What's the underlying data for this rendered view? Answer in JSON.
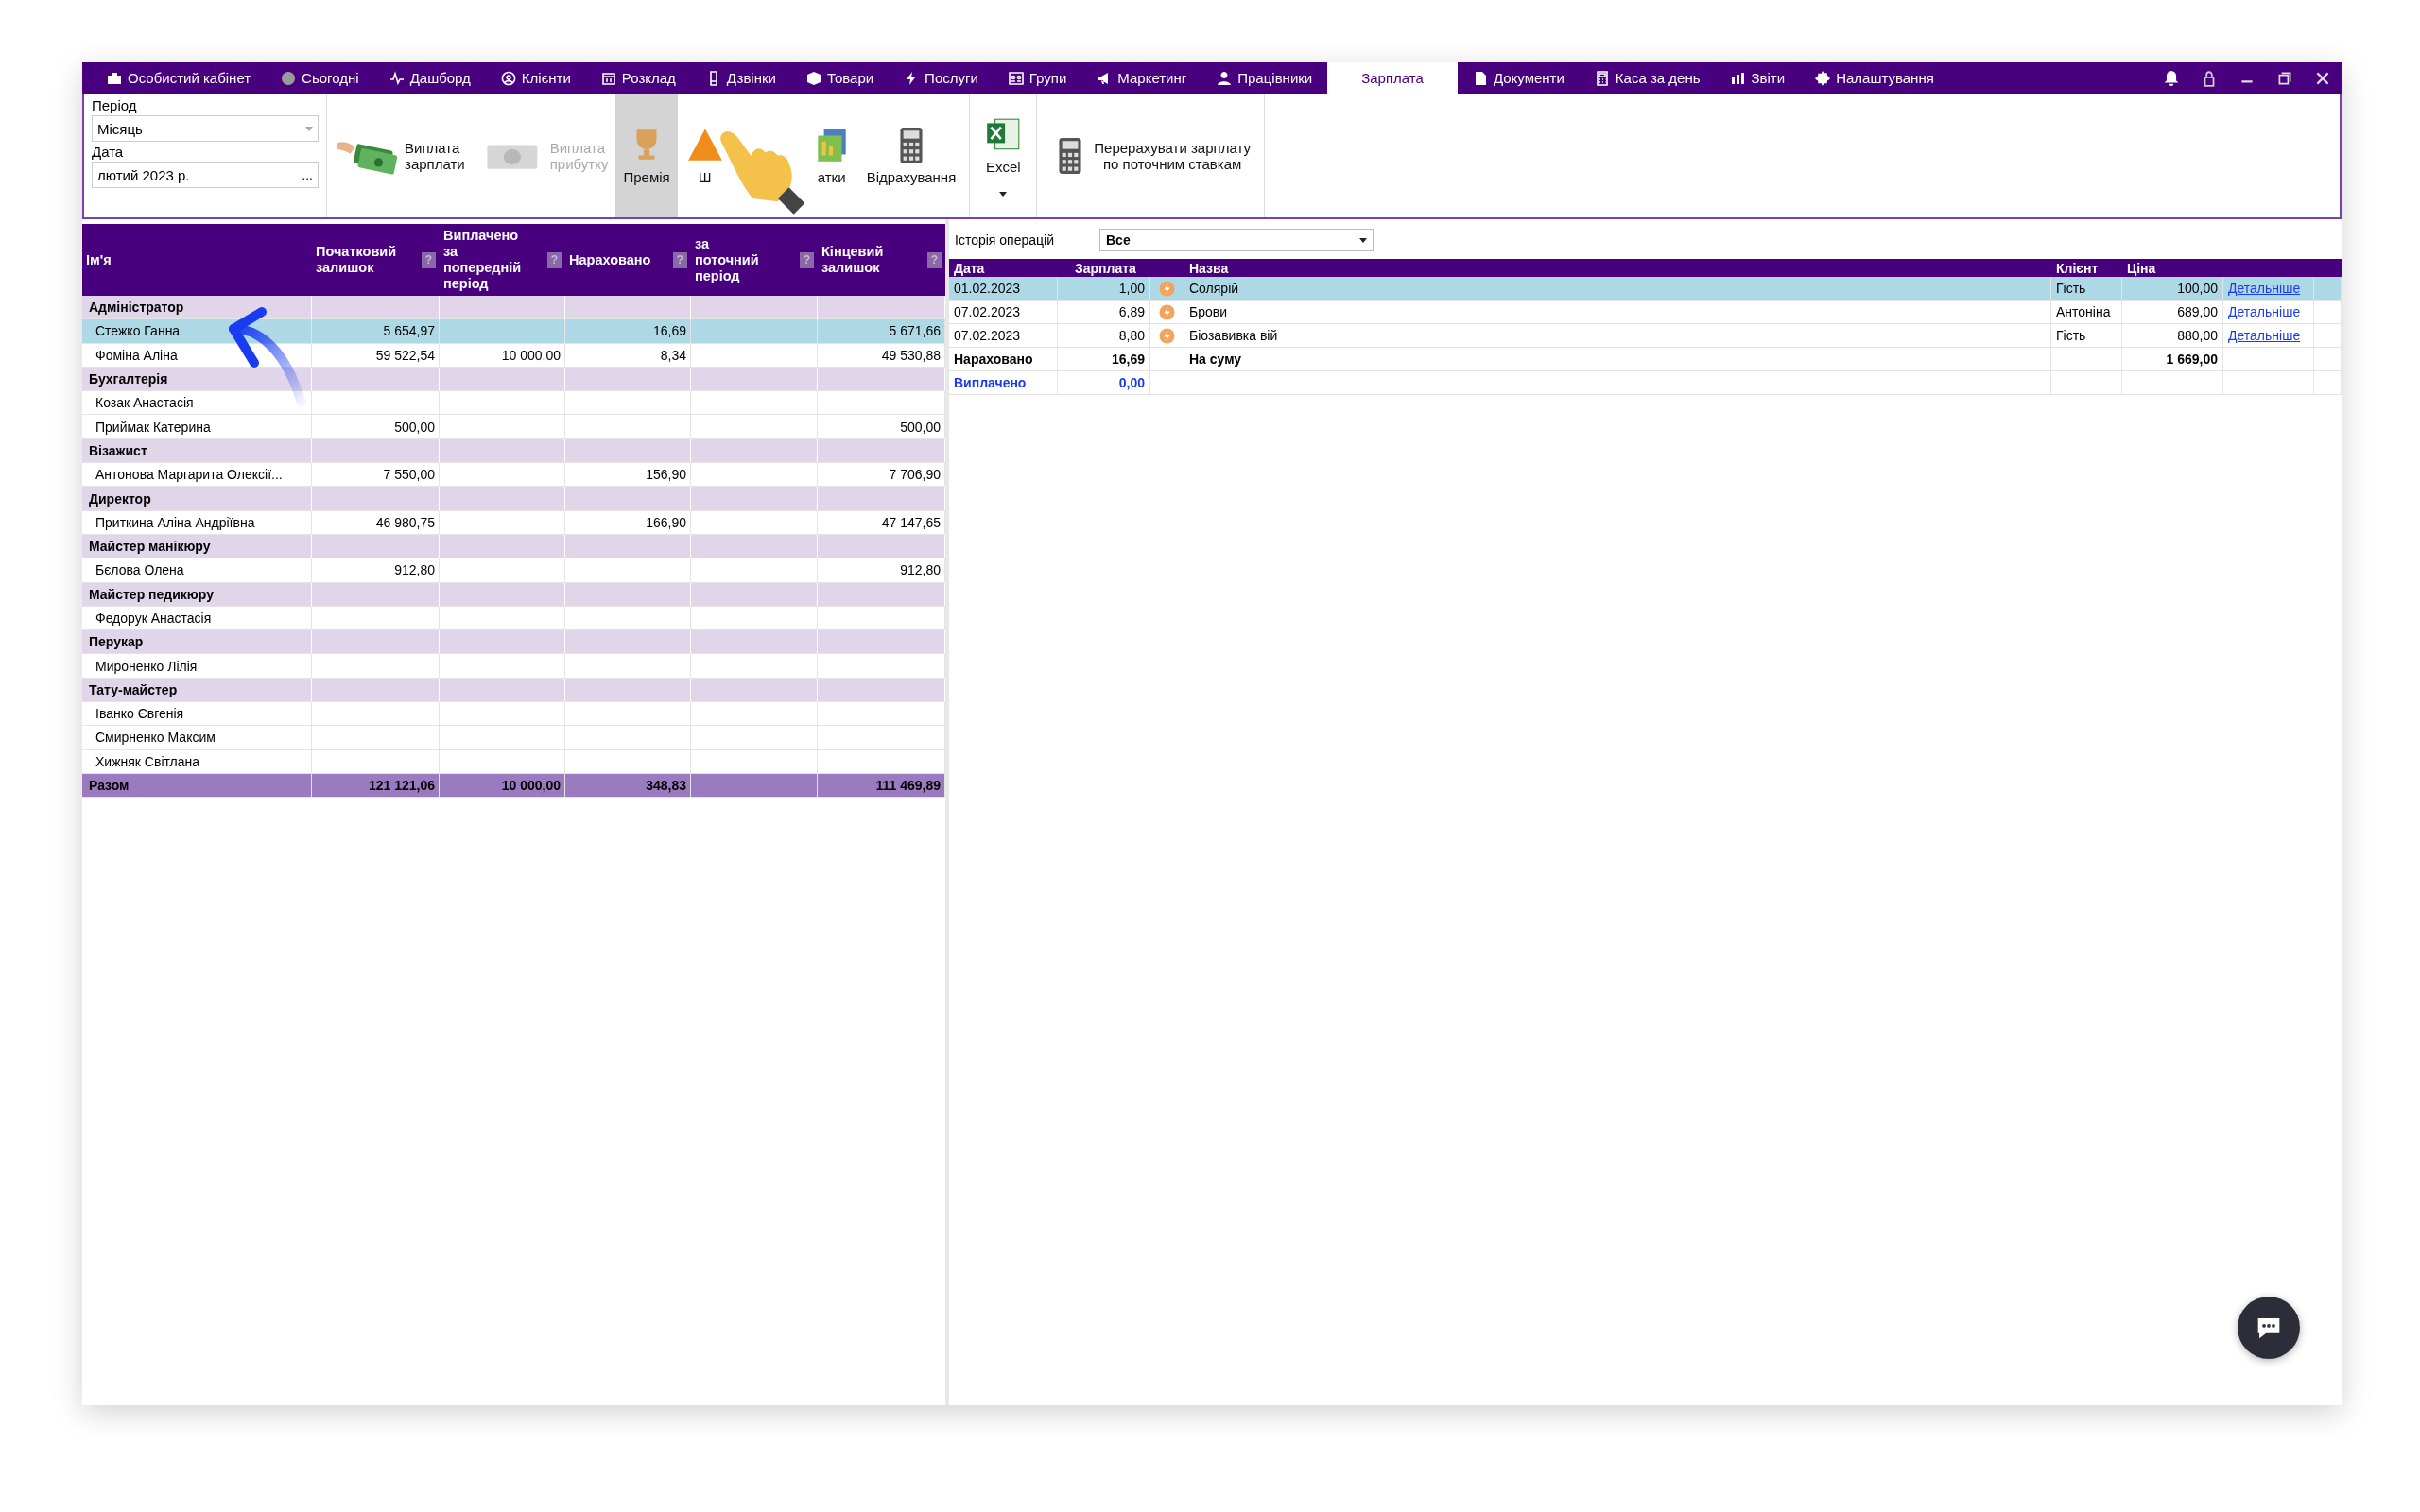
{
  "menu": {
    "items": [
      {
        "label": "Особистий кабінет",
        "selected": false
      },
      {
        "label": "Сьогодні",
        "selected": false
      },
      {
        "label": "Дашборд",
        "selected": false
      },
      {
        "label": "Клієнти",
        "selected": false
      },
      {
        "label": "Розклад",
        "selected": false
      },
      {
        "label": "Дзвінки",
        "selected": false
      },
      {
        "label": "Товари",
        "selected": false
      },
      {
        "label": "Послуги",
        "selected": false
      },
      {
        "label": "Групи",
        "selected": false
      },
      {
        "label": "Маркетинг",
        "selected": false
      },
      {
        "label": "Працівники",
        "selected": false
      },
      {
        "label": "Зарплата",
        "selected": true
      },
      {
        "label": "Документи",
        "selected": false
      },
      {
        "label": "Каса за день",
        "selected": false
      },
      {
        "label": "Звіти",
        "selected": false
      },
      {
        "label": "Налаштування",
        "selected": false
      }
    ]
  },
  "toolbar": {
    "period": {
      "label": "Період",
      "value": "Місяць"
    },
    "date": {
      "label": "Дата",
      "value": "лютий  2023 р.",
      "button": "..."
    },
    "buttons": [
      {
        "label": "Виплата\nзарплати",
        "disabled": false,
        "selected": false
      },
      {
        "label": "Виплата\nприбутку",
        "disabled": true,
        "selected": false
      },
      {
        "label": "Премія",
        "disabled": false,
        "selected": true
      },
      {
        "label": "Ш",
        "disabled": false,
        "selected": false
      },
      {
        "label": "атки",
        "disabled": false,
        "selected": false
      },
      {
        "label": "Відрахування",
        "disabled": false,
        "selected": false
      },
      {
        "label": "Excel",
        "disabled": false,
        "selected": false
      },
      {
        "label": "Перерахувати зарплату\nпо поточним ставкам",
        "disabled": false,
        "selected": false
      }
    ]
  },
  "salary_table": {
    "columns": [
      {
        "label": "Ім'я"
      },
      {
        "label": "Початковий залишок",
        "help": "?"
      },
      {
        "label": "Виплачено за попередній період",
        "help": "?"
      },
      {
        "label": "Нараховано",
        "help": "?"
      },
      {
        "label": "за поточний період",
        "help": "?"
      },
      {
        "label": "Кінцевий залишок",
        "help": "?"
      }
    ],
    "rows": [
      {
        "kind": "group",
        "name": "Адміністратор"
      },
      {
        "kind": "person",
        "name": "Стежко Ганна",
        "values": {
          "initial": "5 654,97",
          "accrued": "16,69",
          "final": "5 671,66"
        },
        "selected": true
      },
      {
        "kind": "person",
        "name": "Фоміна Аліна",
        "values": {
          "initial": "59 522,54",
          "paid_previous": "10 000,00",
          "accrued": "8,34",
          "final": "49 530,88"
        },
        "selected": false
      },
      {
        "kind": "group",
        "name": "Бухгалтерія"
      },
      {
        "kind": "person",
        "name": "Козак Анастасія",
        "selected": false
      },
      {
        "kind": "person",
        "name": "Приймак Катерина",
        "values": {
          "initial": "500,00",
          "final": "500,00"
        },
        "selected": false
      },
      {
        "kind": "group",
        "name": "Візажист"
      },
      {
        "kind": "person",
        "name": "Антонова Маргарита Олексії...",
        "values": {
          "initial": "7 550,00",
          "accrued": "156,90",
          "final": "7 706,90"
        },
        "selected": false
      },
      {
        "kind": "group",
        "name": "Директор"
      },
      {
        "kind": "person",
        "name": "Приткина Аліна Андріївна",
        "values": {
          "initial": "46 980,75",
          "accrued": "166,90",
          "final": "47 147,65"
        },
        "selected": false
      },
      {
        "kind": "group",
        "name": "Майстер манікюру"
      },
      {
        "kind": "person",
        "name": "Бєлова Олена",
        "values": {
          "initial": "912,80",
          "final": "912,80"
        },
        "selected": false
      },
      {
        "kind": "group",
        "name": "Майстер педикюру"
      },
      {
        "kind": "person",
        "name": "Федорук Анастасія",
        "selected": false
      },
      {
        "kind": "group",
        "name": "Перукар"
      },
      {
        "kind": "person",
        "name": "Мироненко Лілія",
        "selected": false
      },
      {
        "kind": "group",
        "name": "Тату-майстер"
      },
      {
        "kind": "person",
        "name": "Іванко Євгенія",
        "selected": false
      },
      {
        "kind": "person",
        "name": "Смирненко Максим",
        "selected": false
      },
      {
        "kind": "person",
        "name": "Хижняк Світлана",
        "selected": false
      },
      {
        "kind": "total",
        "name": "Разом",
        "values": {
          "initial": "121 121,06",
          "paid_previous": "10 000,00",
          "accrued": "348,83",
          "final": "111 469,89"
        }
      }
    ]
  },
  "history": {
    "label": "Історія операцій",
    "filter": "Все",
    "columns": [
      "Дата",
      "Зарплата",
      "Назва",
      "Клієнт",
      "Ціна"
    ],
    "rows": [
      {
        "date": "01.02.2023",
        "salary": "1,00",
        "name": "Солярій",
        "client": "Гість",
        "price": "100,00",
        "link": "Детальніше",
        "selected": true
      },
      {
        "date": "07.02.2023",
        "salary": "6,89",
        "name": "Брови",
        "client": "Антоніна",
        "price": "689,00",
        "link": "Детальніше",
        "selected": false
      },
      {
        "date": "07.02.2023",
        "salary": "8,80",
        "name": "Біозавивка вій",
        "client": "Гість",
        "price": "880,00",
        "link": "Детальніше",
        "selected": false
      }
    ],
    "accrued": {
      "label": "Нараховано",
      "value": "16,69",
      "sum_label": "На суму",
      "sum": "1 669,00"
    },
    "paid": {
      "label": "Виплачено",
      "value": "0,00"
    }
  }
}
